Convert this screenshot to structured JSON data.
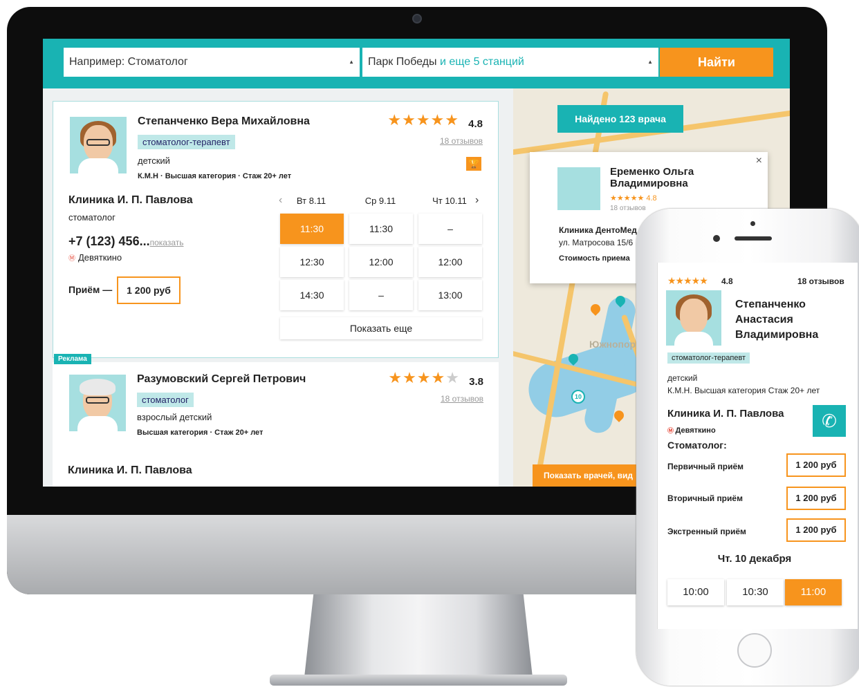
{
  "search": {
    "query_placeholder": "Например: Стоматолог",
    "metro_value": "Парк Победы",
    "metro_more": "и еще 5 станций",
    "find_label": "Найти"
  },
  "cards": [
    {
      "name": "Степанченко Вера Михайловна",
      "specialty": "стоматолог-терапевт",
      "age_group": "детский",
      "credentials": "К.М.Н  ·  Высшая категория  ·  Стаж 20+ лет",
      "stars": "★★★★★",
      "rating": "4.8",
      "reviews": "18 отзывов",
      "clinic": "Клиника И. П. Павлова",
      "clinic_specialty": "стоматолог",
      "phone": "+7 (123) 456...",
      "phone_show": "показать",
      "metro": "Девяткино",
      "price_label": "Приём —",
      "price": "1 200 руб",
      "days": [
        "Вт 8.11",
        "Ср 9.11",
        "Чт 10.11"
      ],
      "slots": [
        [
          "11:30",
          "11:30",
          "–"
        ],
        [
          "12:30",
          "12:00",
          "12:00"
        ],
        [
          "14:30",
          "–",
          "13:00"
        ]
      ],
      "show_more": "Показать еще"
    },
    {
      "ad": "Реклама",
      "name": "Разумовский Сергей Петрович",
      "specialty": "стоматолог",
      "age_group": "взрослый  детский",
      "credentials": "Высшая категория  ·  Стаж 20+ лет",
      "stars_filled": "★★★",
      "stars_half": "★",
      "stars_empty": "★",
      "rating": "3.8",
      "reviews": "18 отзывов",
      "clinic": "Клиника И. П. Павлова"
    }
  ],
  "map": {
    "found": "Найдено 123 врача",
    "popup_name": "Еременко Ольга Владимировна",
    "popup_stars": "★★★★★ 4.8",
    "popup_reviews": "18 отзывов",
    "popup_clinic": "Клиника ДентоМед",
    "popup_address": "ул. Матросова 15/6",
    "popup_cost": "Стоимость приема",
    "close": "×",
    "show_doctors": "Показать врачей, вид",
    "district": "Южнопорт",
    "ttk": "10"
  },
  "mobile": {
    "stars": "★★★★★",
    "rating": "4.8",
    "reviews": "18 отзывов",
    "name": "Степанченко Анастасия Владимировна",
    "specialty": "стоматолог-терапевт",
    "age_group": "детский",
    "credentials": "К.М.Н.  Высшая категория  Стаж 20+ лет",
    "clinic": "Клиника И. П. Павлова",
    "metro": "Девяткино",
    "section": "Стоматолог:",
    "services": [
      {
        "label": "Первичный приём",
        "price": "1 200 руб"
      },
      {
        "label": "Вторичный приём",
        "price": "1 200 руб"
      },
      {
        "label": "Экстренный приём",
        "price": "1 200 руб"
      }
    ],
    "date": "Чт. 10 декабря",
    "times": [
      "10:00",
      "10:30",
      "11:00"
    ]
  },
  "colors": {
    "accent": "#19b3b3",
    "orange": "#f7941d"
  }
}
